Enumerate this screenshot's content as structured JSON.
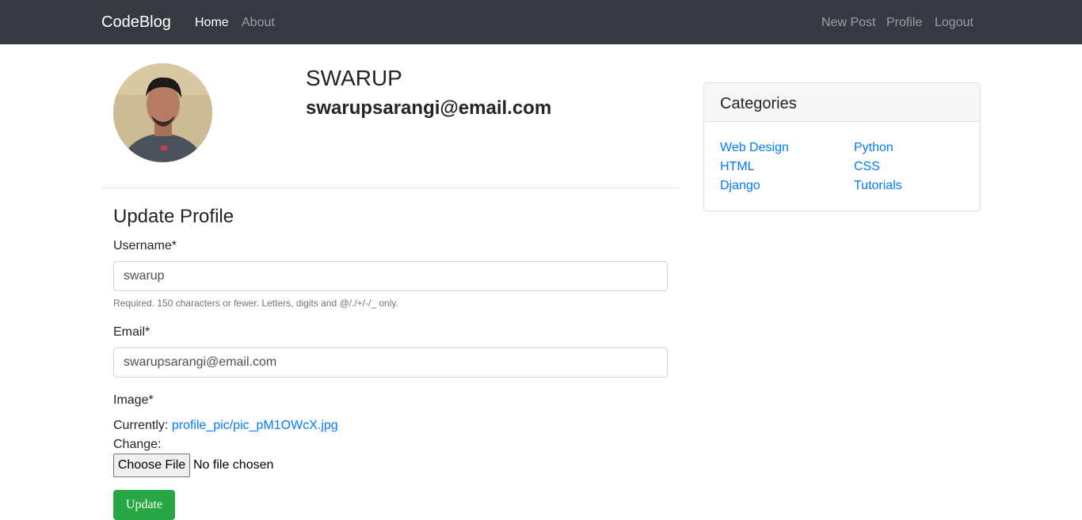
{
  "navbar": {
    "brand": "CodeBlog",
    "left_links": [
      "Home",
      "About"
    ],
    "right_links": [
      "New Post",
      "Profile",
      "Logout"
    ]
  },
  "profile": {
    "name": "SWARUP",
    "email": "swarupsarangi@email.com"
  },
  "form": {
    "title": "Update Profile",
    "username_label": "Username*",
    "username_value": "swarup",
    "username_help": "Required. 150 characters or fewer. Letters, digits and @/./+/-/_ only.",
    "email_label": "Email*",
    "email_value": "swarupsarangi@email.com",
    "image_label": "Image*",
    "currently_label": "Currently:",
    "current_file": "profile_pic/pic_pM1OWcX.jpg",
    "change_label": "Change:",
    "choose_file_label": "Choose File",
    "file_status": "No file chosen",
    "submit_label": "Update"
  },
  "sidebar": {
    "title": "Categories",
    "categories": [
      "Web Design",
      "Python",
      "HTML",
      "CSS",
      "Django",
      "Tutorials"
    ]
  },
  "colors": {
    "navbar_bg": "#343a40",
    "link": "#007bff",
    "success": "#28a745"
  }
}
